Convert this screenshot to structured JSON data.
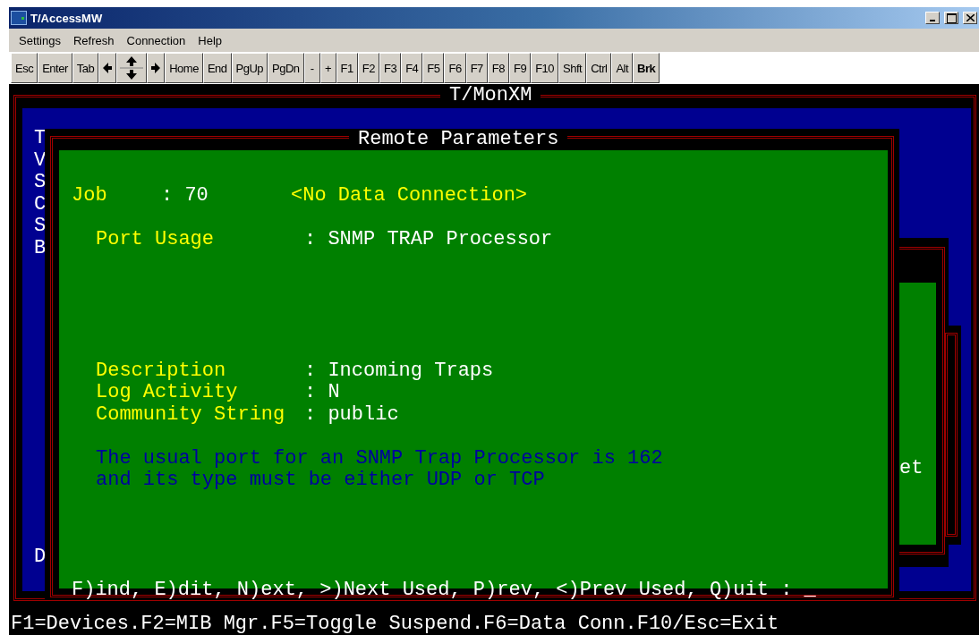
{
  "window": {
    "title": "T/AccessMW"
  },
  "menu": [
    "Settings",
    "Refresh",
    "Connection",
    "Help"
  ],
  "keys": [
    {
      "kind": "text",
      "label": "Esc"
    },
    {
      "kind": "text",
      "label": "Enter"
    },
    {
      "kind": "text",
      "label": "Tab"
    },
    {
      "kind": "left"
    },
    {
      "kind": "updown"
    },
    {
      "kind": "right"
    },
    {
      "kind": "text",
      "label": "Home"
    },
    {
      "kind": "text",
      "label": "End"
    },
    {
      "kind": "text",
      "label": "PgUp"
    },
    {
      "kind": "text",
      "label": "PgDn"
    },
    {
      "kind": "text",
      "label": "-"
    },
    {
      "kind": "text",
      "label": "+"
    },
    {
      "kind": "text",
      "label": "F1"
    },
    {
      "kind": "text",
      "label": "F2"
    },
    {
      "kind": "text",
      "label": "F3"
    },
    {
      "kind": "text",
      "label": "F4"
    },
    {
      "kind": "text",
      "label": "F5"
    },
    {
      "kind": "text",
      "label": "F6"
    },
    {
      "kind": "text",
      "label": "F7"
    },
    {
      "kind": "text",
      "label": "F8"
    },
    {
      "kind": "text",
      "label": "F9"
    },
    {
      "kind": "text",
      "label": "F10"
    },
    {
      "kind": "text",
      "label": "Shft"
    },
    {
      "kind": "text",
      "label": "Ctrl"
    },
    {
      "kind": "text",
      "label": "Alt"
    },
    {
      "kind": "bold",
      "label": "Brk"
    }
  ],
  "terminal": {
    "title": "T/MonXM",
    "side_letters": [
      "T",
      "V",
      "S",
      "C",
      "S",
      "B"
    ],
    "side_letter_bottom": "D",
    "background_fragment": "et",
    "dialog": {
      "title": "Remote Parameters",
      "job_label": "Job",
      "job_value": ": 70",
      "connection_status": "<No Data Connection>",
      "port_usage": {
        "label": "Port Usage",
        "value": ": SNMP TRAP Processor"
      },
      "fields": [
        {
          "label": "Description",
          "value": ": Incoming Traps"
        },
        {
          "label": "Log Activity",
          "value": ": N"
        },
        {
          "label": "Community String",
          "value": ": public"
        }
      ],
      "note": [
        "The usual port for an SNMP Trap Processor is 162",
        "and its type must be either UDP or TCP"
      ],
      "prompt": "F)ind, E)dit, N)ext, >)Next Used, P)rev, <)Prev Used, Q)uit : _"
    }
  },
  "status_line": "F1=Devices.F2=MIB Mgr.F5=Toggle Suspend.F6=Data Conn.F10/Esc=Exit"
}
